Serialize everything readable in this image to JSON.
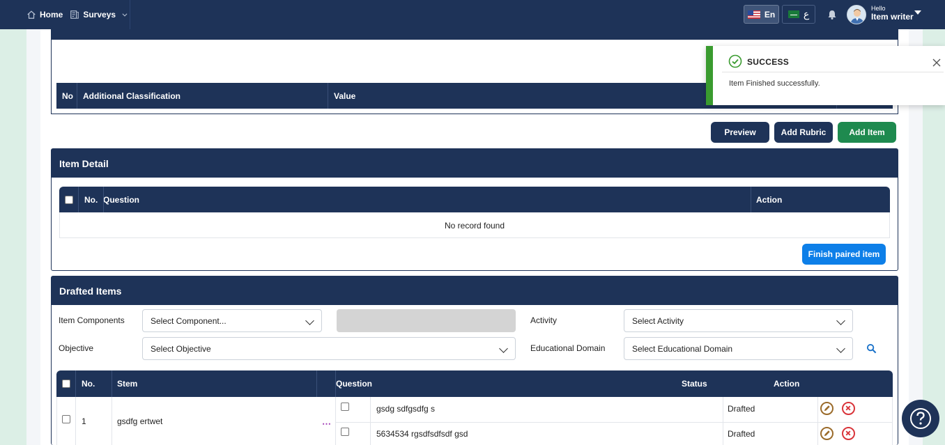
{
  "nav": {
    "home": "Home",
    "surveys": "Surveys"
  },
  "lang": {
    "en": "En",
    "ar": "ع"
  },
  "user": {
    "hello": "Hello",
    "name": "Item writer"
  },
  "classification_table": {
    "col_no": "No",
    "col_class": "Additional Classification",
    "col_value": "Value"
  },
  "actions": {
    "preview": "Preview",
    "add_rubric": "Add Rubric",
    "add_item": "Add Item"
  },
  "item_detail": {
    "title": "Item Detail",
    "col_no": "No.",
    "col_question": "Question",
    "col_action": "Action",
    "empty": "No record found",
    "finish_button": "Finish paired item"
  },
  "drafted": {
    "title": "Drafted Items",
    "filters": {
      "component_label": "Item Components",
      "component_value": "Select Component...",
      "activity_label": "Activity",
      "activity_value": "Select Activity",
      "objective_label": "Objective",
      "objective_value": "Select Objective",
      "domain_label": "Educational Domain",
      "domain_value": "Select Educational Domain"
    },
    "columns": {
      "no": "No.",
      "stem": "Stem",
      "question": "Question",
      "status": "Status",
      "action": "Action"
    },
    "rows": [
      {
        "no": "1",
        "stem": "gsdfg ertwet",
        "questions": [
          {
            "text": "gsdg sdfgsdfg s",
            "status": "Drafted"
          },
          {
            "text": "5634534 rgsdfsdfsdf gsd",
            "status": "Drafted"
          }
        ]
      }
    ]
  },
  "toast": {
    "title": "SUCCESS",
    "message": "Item Finished successfully."
  },
  "colors": {
    "navy": "#1e3358",
    "green": "#1e8a4f",
    "blue": "#0d7fe8",
    "success": "#3a9b2f"
  }
}
